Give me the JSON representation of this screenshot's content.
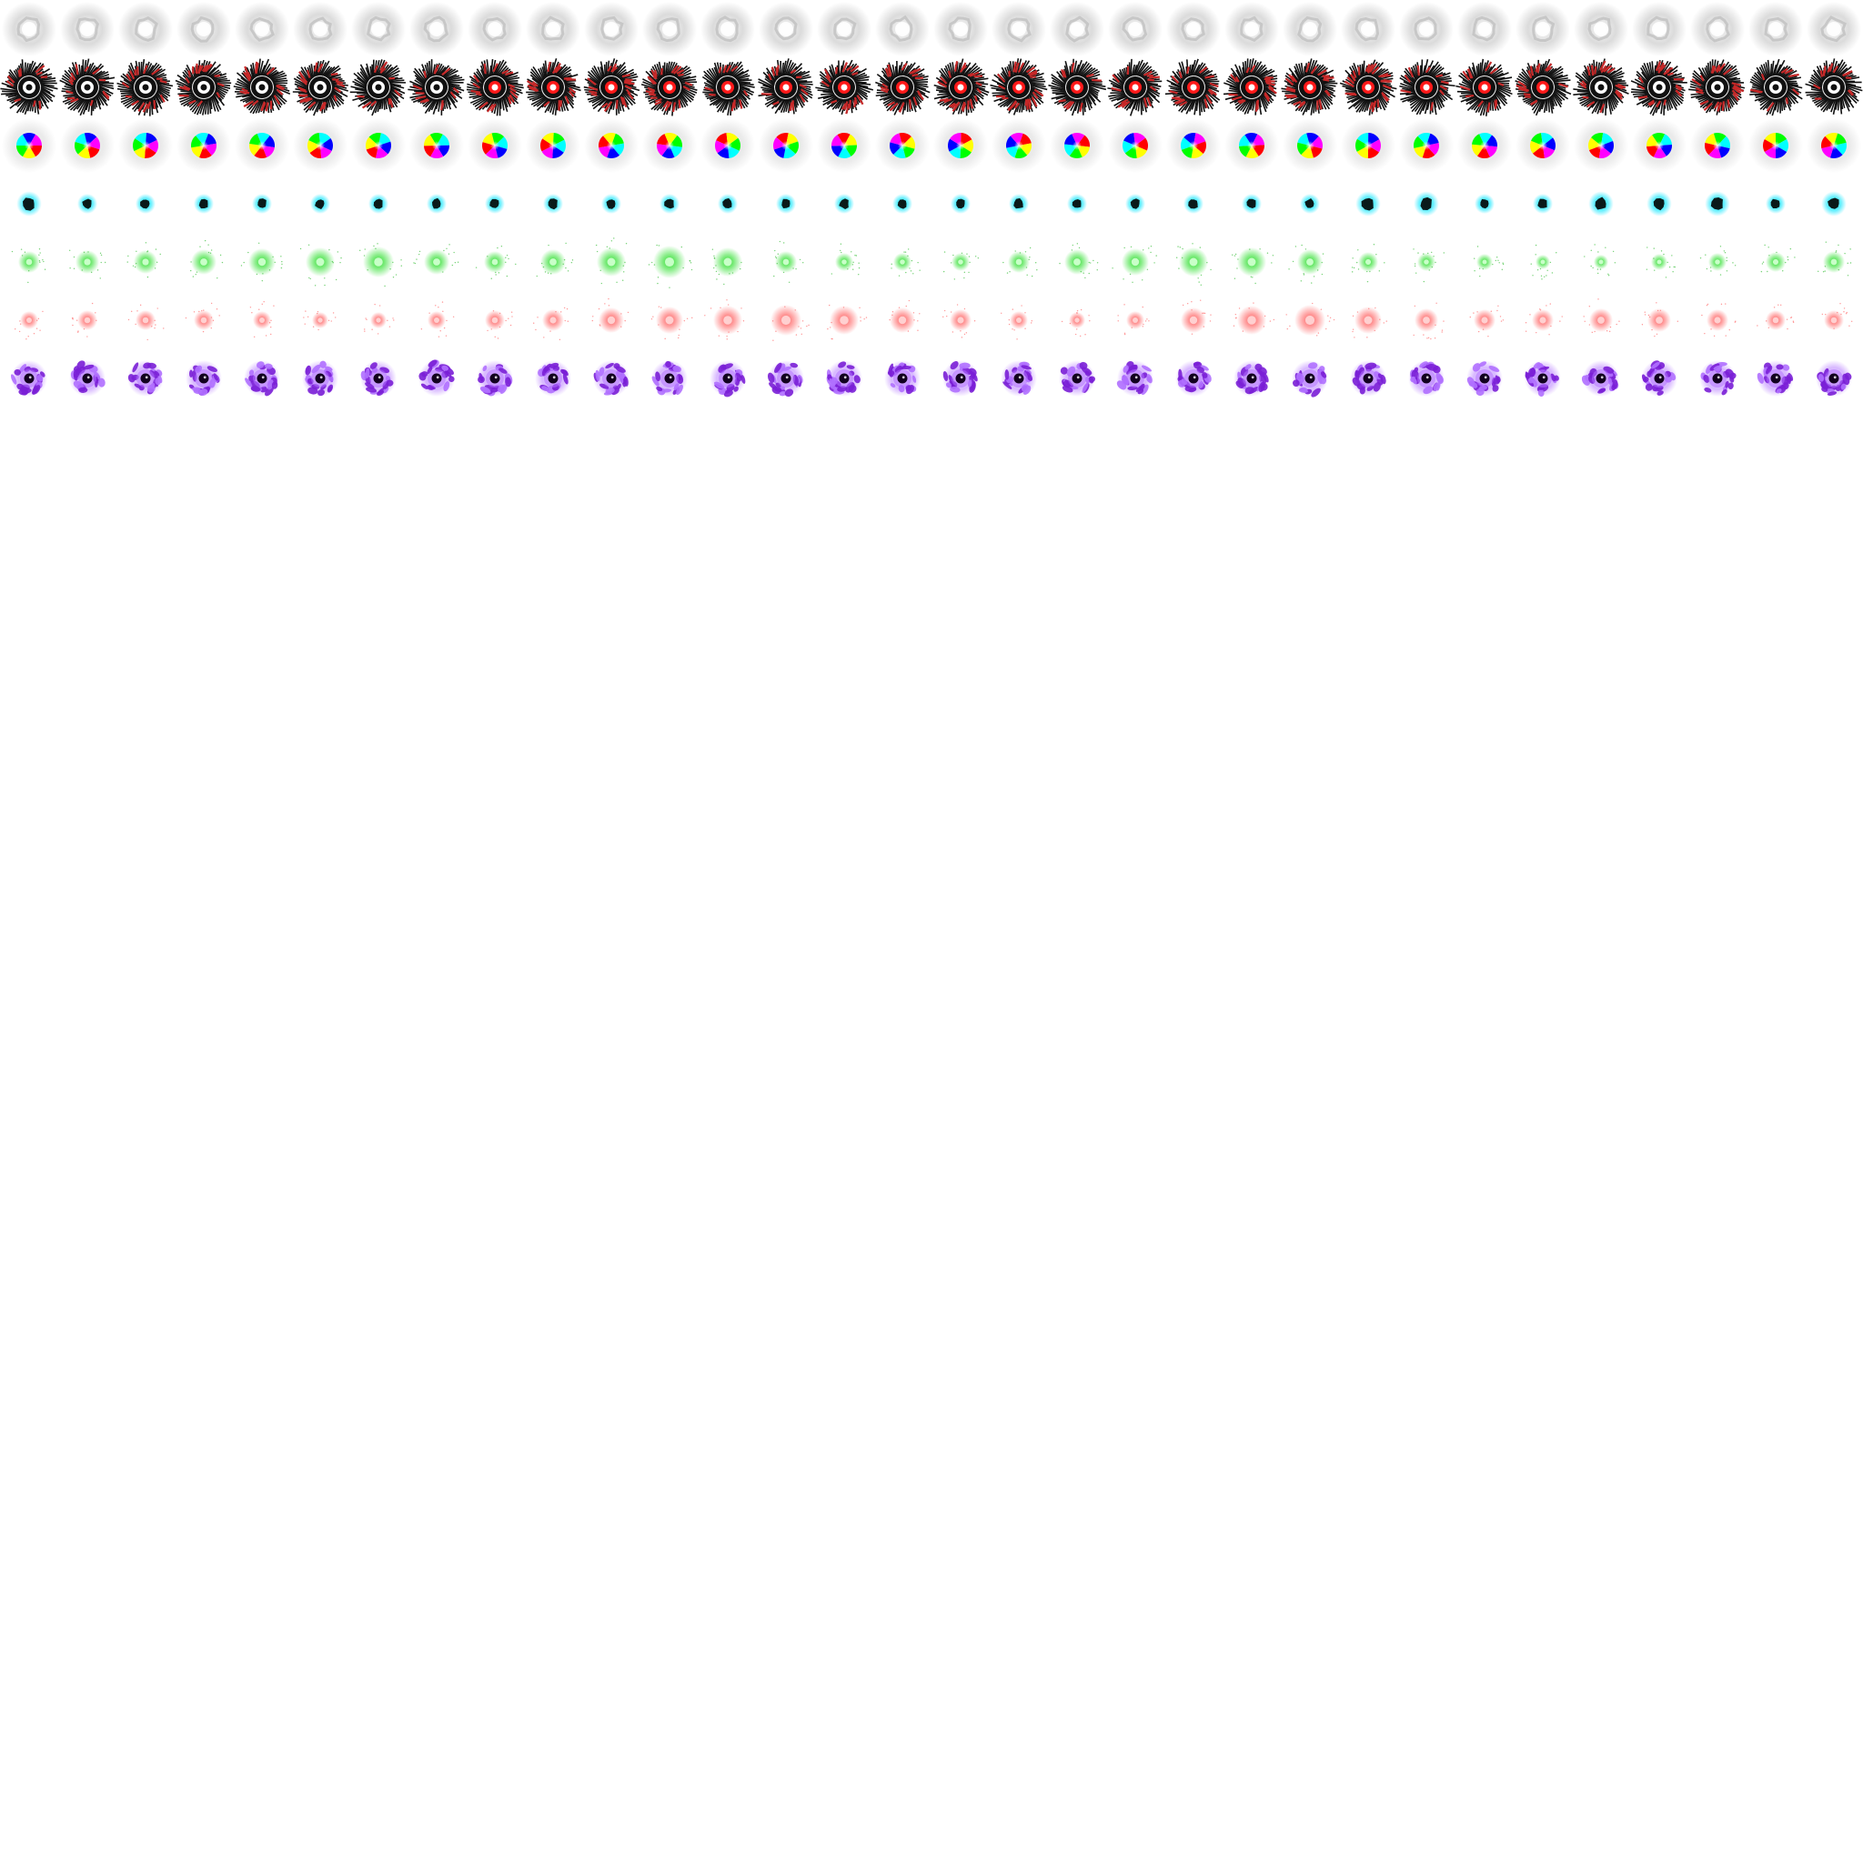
{
  "sprite_sheet": {
    "background": "#ffffff",
    "frames_per_row": 32,
    "rows": [
      {
        "name": "white-smoke-ring",
        "colors": {
          "glow": "#d9d9d9",
          "ring": "#bdbdbd",
          "core": "#ffffff"
        }
      },
      {
        "name": "black-red-spiral-vortex",
        "colors": {
          "spikes": "#111111",
          "band": "#c62828",
          "core": "#ffffff",
          "accent": "#ff1a1a"
        }
      },
      {
        "name": "rainbow-color-wheel",
        "colors": {
          "glow": "#e2e2e2",
          "wheel": [
            "#ff0000",
            "#ffff00",
            "#00ff00",
            "#00ffff",
            "#0000ff",
            "#ff00ff"
          ]
        }
      },
      {
        "name": "cyan-dark-orb",
        "colors": {
          "glow": "#00e5ff",
          "core": "#0a1a1a"
        }
      },
      {
        "name": "green-spark-burst",
        "colors": {
          "glow": "#22dd22",
          "core": "#c8ffc8",
          "particles": "#3bbf3b"
        }
      },
      {
        "name": "red-spark-burst",
        "colors": {
          "glow": "#ff5555",
          "core": "#ffd0d0",
          "particles": "#ff6b6b"
        }
      },
      {
        "name": "purple-energy-vortex",
        "colors": {
          "outer": "#7a1fd6",
          "mid": "#b070ff",
          "core": "#12001f"
        }
      }
    ]
  }
}
